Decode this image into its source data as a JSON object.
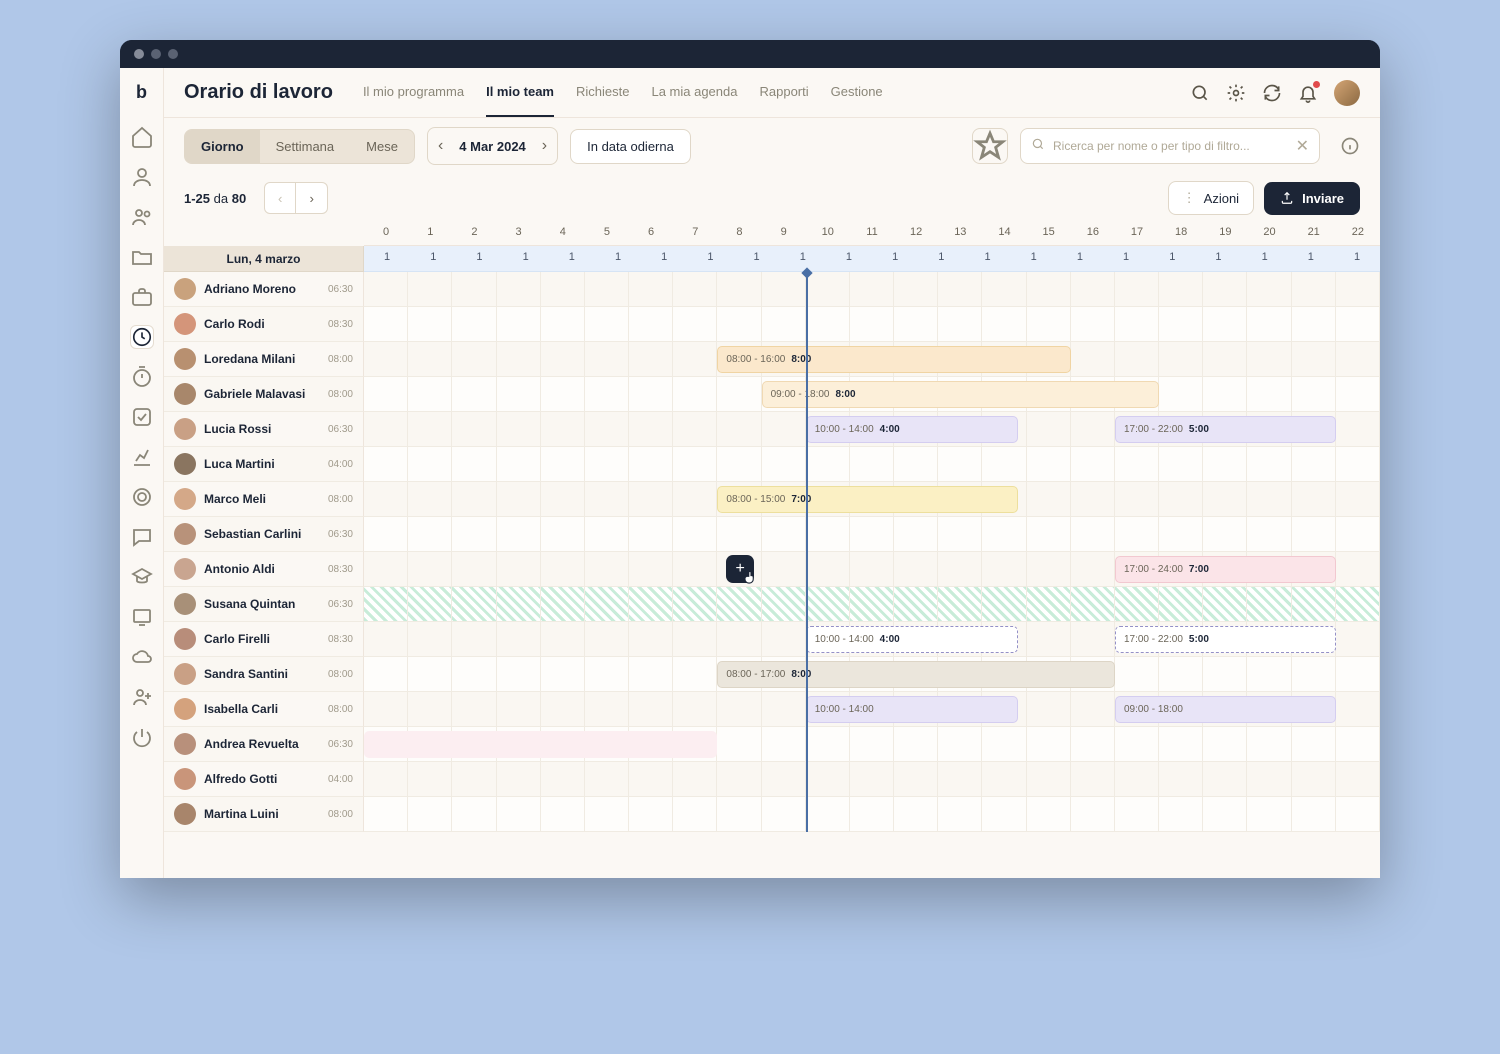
{
  "header": {
    "title": "Orario di lavoro",
    "tabs": [
      "Il mio programma",
      "Il mio team",
      "Richieste",
      "La mia agenda",
      "Rapporti",
      "Gestione"
    ],
    "activeTab": 1
  },
  "toolbar": {
    "viewSegments": [
      "Giorno",
      "Settimana",
      "Mese"
    ],
    "activeSegment": 0,
    "dateLabel": "4 Mar 2024",
    "todayLabel": "In data odierna",
    "searchPlaceholder": "Ricerca per nome o per tipo di filtro..."
  },
  "subbar": {
    "rangeFrom": "1-25",
    "rangeMid": "da",
    "rangeTotal": "80",
    "actionsLabel": "Azioni",
    "sendLabel": "Inviare"
  },
  "schedule": {
    "dateHeader": "Lun, 4 marzo",
    "hours": [
      "0",
      "1",
      "2",
      "3",
      "4",
      "5",
      "6",
      "7",
      "8",
      "9",
      "10",
      "11",
      "12",
      "13",
      "14",
      "15",
      "16",
      "17",
      "18",
      "19",
      "20",
      "21",
      "22"
    ],
    "counts": [
      "1",
      "1",
      "1",
      "1",
      "1",
      "1",
      "1",
      "1",
      "1",
      "1",
      "1",
      "1",
      "1",
      "1",
      "1",
      "1",
      "1",
      "1",
      "1",
      "1",
      "1",
      "1"
    ],
    "nowHour": 10,
    "employees": [
      {
        "name": "Adriano Moreno",
        "time": "06:30",
        "avatar": "#c9a27d"
      },
      {
        "name": "Carlo Rodi",
        "time": "08:30",
        "avatar": "#d4957a"
      },
      {
        "name": "Loredana Milani",
        "time": "08:00",
        "avatar": "#b89070"
      },
      {
        "name": "Gabriele Malavasi",
        "time": "08:00",
        "avatar": "#a8876b"
      },
      {
        "name": "Lucia Rossi",
        "time": "06:30",
        "avatar": "#c9a085"
      },
      {
        "name": "Luca Martini",
        "time": "04:00",
        "avatar": "#8a7560"
      },
      {
        "name": "Marco Meli",
        "time": "08:00",
        "avatar": "#d4a888"
      },
      {
        "name": "Sebastian Carlini",
        "time": "06:30",
        "avatar": "#b8927a"
      },
      {
        "name": "Antonio Aldi",
        "time": "08:30",
        "avatar": "#c9a590"
      },
      {
        "name": "Susana Quintan",
        "time": "06:30",
        "avatar": "#a89078"
      },
      {
        "name": "Carlo Firelli",
        "time": "08:30",
        "avatar": "#b88d7a"
      },
      {
        "name": "Sandra Santini",
        "time": "08:00",
        "avatar": "#c9a085"
      },
      {
        "name": "Isabella Carli",
        "time": "08:00",
        "avatar": "#d4a27d"
      },
      {
        "name": "Andrea Revuelta",
        "time": "06:30",
        "avatar": "#b8907b"
      },
      {
        "name": "Alfredo Gotti",
        "time": "04:00",
        "avatar": "#c9957a"
      },
      {
        "name": "Martina Luini",
        "time": "08:00",
        "avatar": "#a8856b"
      }
    ],
    "shifts": [
      {
        "row": 2,
        "start": 8,
        "end": 16,
        "time": "08:00 - 16:00",
        "dur": "8:00",
        "cls": "sh-orange"
      },
      {
        "row": 3,
        "start": 9,
        "end": 18,
        "time": "09:00 - 18:00",
        "dur": "8:00",
        "cls": "sh-orange2"
      },
      {
        "row": 4,
        "start": 10,
        "end": 14.8,
        "time": "10:00 - 14:00",
        "dur": "4:00",
        "cls": "sh-purple"
      },
      {
        "row": 4,
        "start": 17,
        "end": 22,
        "time": "17:00 - 22:00",
        "dur": "5:00",
        "cls": "sh-purple"
      },
      {
        "row": 6,
        "start": 8,
        "end": 14.8,
        "time": "08:00 - 15:00",
        "dur": "7:00",
        "cls": "sh-yellow"
      },
      {
        "row": 8,
        "start": 17,
        "end": 22,
        "time": "17:00 - 24:00",
        "dur": "7:00",
        "cls": "sh-pink"
      },
      {
        "row": 10,
        "start": 10,
        "end": 14.8,
        "time": "10:00 - 14:00",
        "dur": "4:00",
        "cls": "sh-dashed"
      },
      {
        "row": 10,
        "start": 17,
        "end": 22,
        "time": "17:00 - 22:00",
        "dur": "5:00",
        "cls": "sh-dashed"
      },
      {
        "row": 11,
        "start": 8,
        "end": 17,
        "time": "08:00 - 17:00",
        "dur": "8:00",
        "cls": "sh-gray"
      },
      {
        "row": 12,
        "start": 10,
        "end": 14.8,
        "time": "10:00 - 14:00",
        "dur": "",
        "cls": "sh-purple"
      },
      {
        "row": 12,
        "start": 17,
        "end": 22,
        "time": "09:00 - 18:00",
        "dur": "",
        "cls": "sh-purple"
      },
      {
        "row": 13,
        "start": 0,
        "end": 8,
        "time": "",
        "dur": "",
        "cls": "sh-pinkbar"
      }
    ],
    "hatchedRow": 9,
    "addButton": {
      "row": 8,
      "hour": 8.2
    }
  }
}
